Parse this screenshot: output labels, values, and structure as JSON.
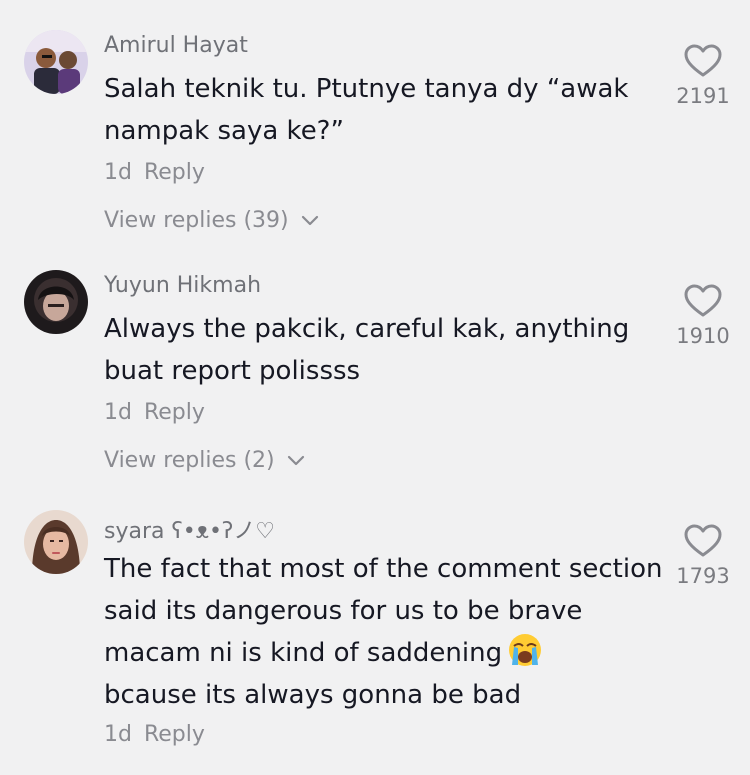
{
  "comments": [
    {
      "username": "Amirul Hayat",
      "text": "Salah teknik tu. Ptutnye tanya dy “awak nampak saya ke?”",
      "time": "1d",
      "reply_label": "Reply",
      "view_replies": "View replies (39)",
      "likes": "2191",
      "heart_icon": "heart-outline-icon"
    },
    {
      "username": "Yuyun Hikmah",
      "text": "Always the pakcik, careful kak, anything buat report polissss",
      "time": "1d",
      "reply_label": "Reply",
      "view_replies": "View replies (2)",
      "likes": "1910",
      "heart_icon": "heart-outline-icon"
    },
    {
      "username": "syara ʕ•ᴥ•ʔノ♡",
      "text": "The fact that most of the comment section said its dangerous for us to be brave macam ni is kind of saddening",
      "text_after_emoji": "bcause its always gonna be bad",
      "emoji": "loudly-crying-face-emoji",
      "time": "1d",
      "reply_label": "Reply",
      "likes": "1793",
      "heart_icon": "heart-outline-icon"
    }
  ],
  "colors": {
    "background": "#f1f1f2",
    "text": "#161823",
    "muted": "#8a8b91"
  }
}
